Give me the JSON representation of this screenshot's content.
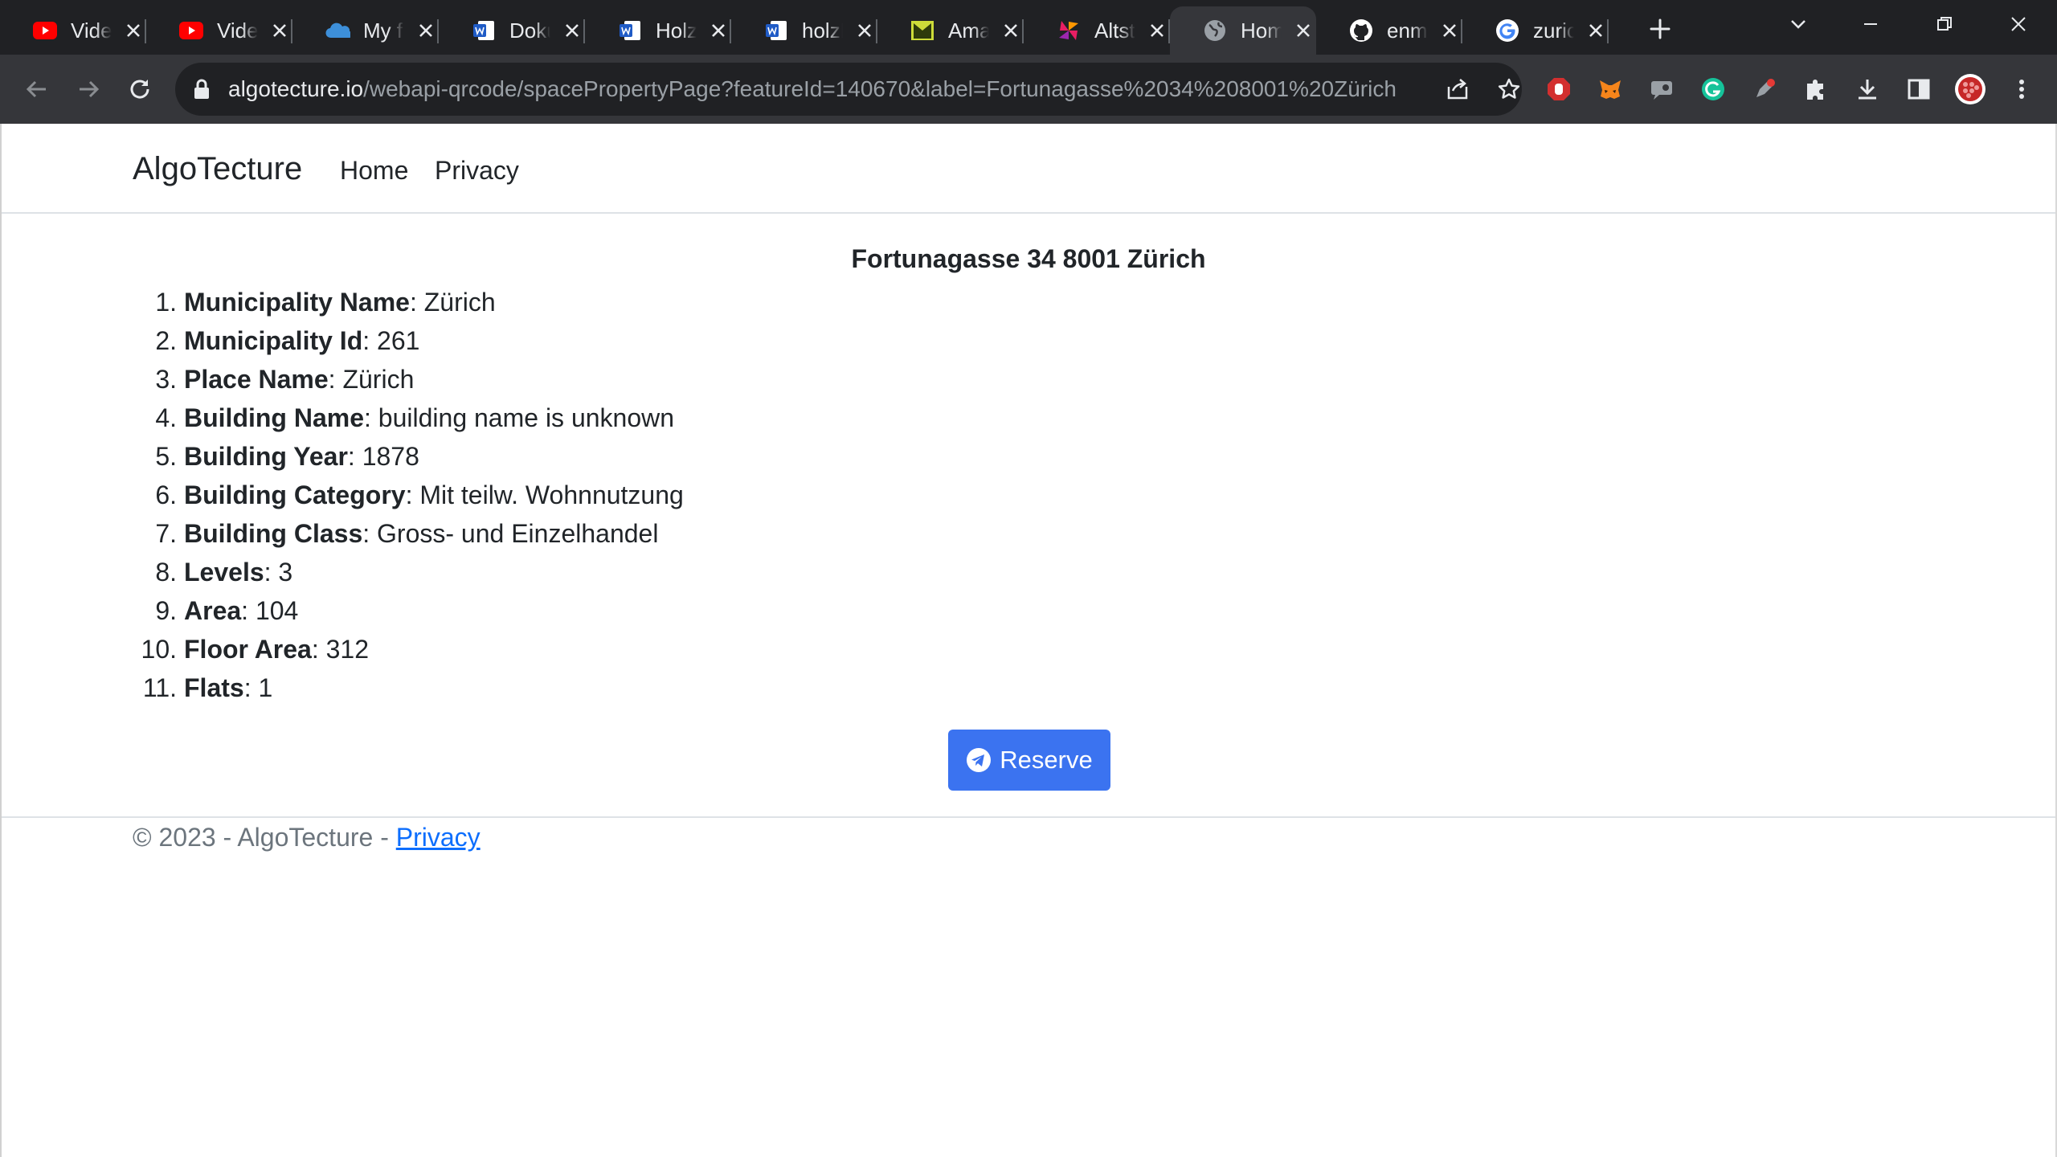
{
  "browser": {
    "tabs": [
      {
        "title": "Video",
        "icon": "youtube-icon",
        "active": false
      },
      {
        "title": "Video",
        "icon": "youtube-icon",
        "active": false
      },
      {
        "title": "My fi",
        "icon": "onedrive-icon",
        "active": false
      },
      {
        "title": "Doku",
        "icon": "word-icon",
        "active": false
      },
      {
        "title": "Holz",
        "icon": "word-icon",
        "active": false
      },
      {
        "title": "holzE",
        "icon": "word-icon",
        "active": false
      },
      {
        "title": "Amaz",
        "icon": "mail-icon",
        "active": false
      },
      {
        "title": "Altsta",
        "icon": "pinwheel-icon",
        "active": false
      },
      {
        "title": "Hom",
        "icon": "globe-icon",
        "active": true
      },
      {
        "title": "enme",
        "icon": "github-icon",
        "active": false
      },
      {
        "title": "zurich",
        "icon": "google-icon",
        "active": false
      }
    ],
    "url_host": "algotecture.io",
    "url_path": "/webapi-qrcode/spacePropertyPage?featureId=140670&label=Fortunagasse%2034%208001%20Zürich"
  },
  "navbar": {
    "brand": "AlgoTecture",
    "links": [
      "Home",
      "Privacy"
    ]
  },
  "page_title": "Fortunagasse 34 8001 Zürich",
  "properties": [
    {
      "num": "1.",
      "label": "Municipality Name",
      "value": ": Zürich"
    },
    {
      "num": "2.",
      "label": "Municipality Id",
      "value": ": 261"
    },
    {
      "num": "3.",
      "label": "Place Name",
      "value": ": Zürich"
    },
    {
      "num": "4.",
      "label": "Building Name",
      "value": ": building name is unknown"
    },
    {
      "num": "5.",
      "label": "Building Year",
      "value": ": 1878"
    },
    {
      "num": "6.",
      "label": "Building Category",
      "value": ": Mit teilw. Wohnnutzung"
    },
    {
      "num": "7.",
      "label": "Building Class",
      "value": ": Gross- und Einzelhandel"
    },
    {
      "num": "8.",
      "label": "Levels",
      "value": ": 3"
    },
    {
      "num": "9.",
      "label": "Area",
      "value": ": 104"
    },
    {
      "num": "10.",
      "label": "Floor Area",
      "value": ": 312"
    },
    {
      "num": "11.",
      "label": "Flats",
      "value": ": 1"
    }
  ],
  "reserve_button": {
    "label": "Reserve",
    "icon": "telegram-icon",
    "color": "#3b73f0"
  },
  "footer": {
    "text": "© 2023 - AlgoTecture - ",
    "link": "Privacy"
  }
}
